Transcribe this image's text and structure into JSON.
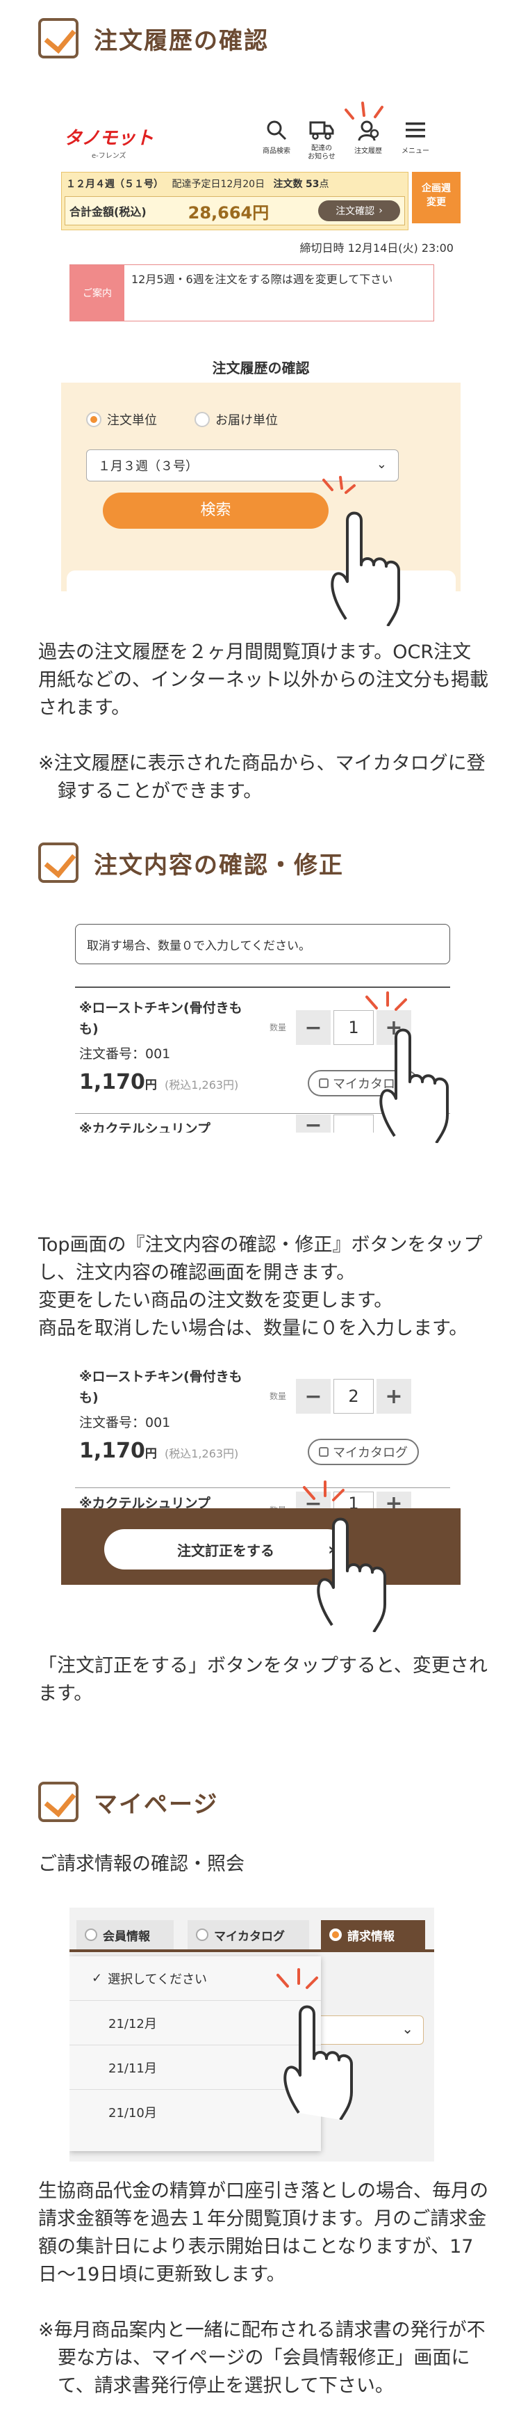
{
  "sections": {
    "history": {
      "title": "注文履歴の確認"
    },
    "edit": {
      "title": "注文内容の確認・修正"
    },
    "mypage": {
      "title": "マイページ"
    }
  },
  "app": {
    "logo": "タノモット",
    "logo_sub": "e-フレンズ",
    "nav": [
      {
        "label": "商品検索",
        "icon": "magnifier-icon"
      },
      {
        "label": "配達の\nお知らせ",
        "icon": "truck-icon"
      },
      {
        "label": "注文履歴",
        "icon": "person-icon"
      },
      {
        "label": "メニュー",
        "icon": "hamburger-icon"
      }
    ],
    "week_label": "１２月４週（５１号）",
    "delivery_label": "配達予定日12月20日",
    "order_count_label": "注文数",
    "order_count": "53",
    "order_count_unit": "点",
    "total_label": "合計金額(税込)",
    "total_value": "28,664円",
    "confirm_button": "注文確認",
    "week_change_button": "企画週\n変更",
    "deadline": "締切日時 12月14日(火) 23:00",
    "notice_tag": "ご案内",
    "notice_text": "12月5週・6週を注文をする際は週を変更して下さい"
  },
  "history_panel": {
    "title": "注文履歴の確認",
    "radio_order": "注文単位",
    "radio_delivery": "お届け単位",
    "select_value": "１月３週（３号）",
    "search_button": "検索"
  },
  "history_text": [
    "過去の注文履歴を２ヶ月間閲覧頂けます。OCR注文用紙などの、インターネット以外からの注文分も掲載されます。",
    "※注文履歴に表示された商品から、マイカタログに登録することができます。"
  ],
  "edit_screen1": {
    "hint": "取消す場合、数量０で入力してください。",
    "item1_name": "※ローストチキン(骨付きもも)",
    "qty_label": "数量",
    "item1_qty": "1",
    "order_no": "注文番号：001",
    "item1_price": "1,170",
    "price_unit": "円",
    "item1_tax": "(税込1,263円)",
    "mycatalog": "マイカタログ",
    "item2_name": "※カクテルシュリンプ"
  },
  "edit_text": [
    "Top画面の『注文内容の確認・修正』ボタンをタップし、注文内容の確認画面を開きます。",
    "変更をしたい商品の注文数を変更します。",
    "商品を取消したい場合は、数量に０を入力します。"
  ],
  "edit_screen2": {
    "item1_qty": "2",
    "item2_qty": "1",
    "submit_button": "注文訂正をする"
  },
  "edit_text2": "「注文訂正をする」ボタンをタップすると、変更されます。",
  "mypage_sub": "ご請求情報の確認・照会",
  "mypage_screen": {
    "tabs": [
      "会員情報",
      "マイカタログ",
      "請求情報"
    ],
    "dropdown_items": [
      "選択してください",
      "21/12月",
      "21/11月",
      "21/10月"
    ]
  },
  "mypage_text": [
    "生協商品代金の精算が口座引き落としの場合、毎月の請求金額等を過去１年分閲覧頂けます。月のご請求金額の集計日により表示開始日はことなりますが、17日～19日頃に更新致します。",
    "※毎月商品案内と一緒に配布される請求書の発行が不要な方は、マイページの「会員情報修正」画面にて、請求書発行停止を選択して下さい。"
  ],
  "colors": {
    "brown": "#6b4a32",
    "orange": "#f29135",
    "red": "#e02020",
    "notice_pink": "#f08a8a"
  }
}
